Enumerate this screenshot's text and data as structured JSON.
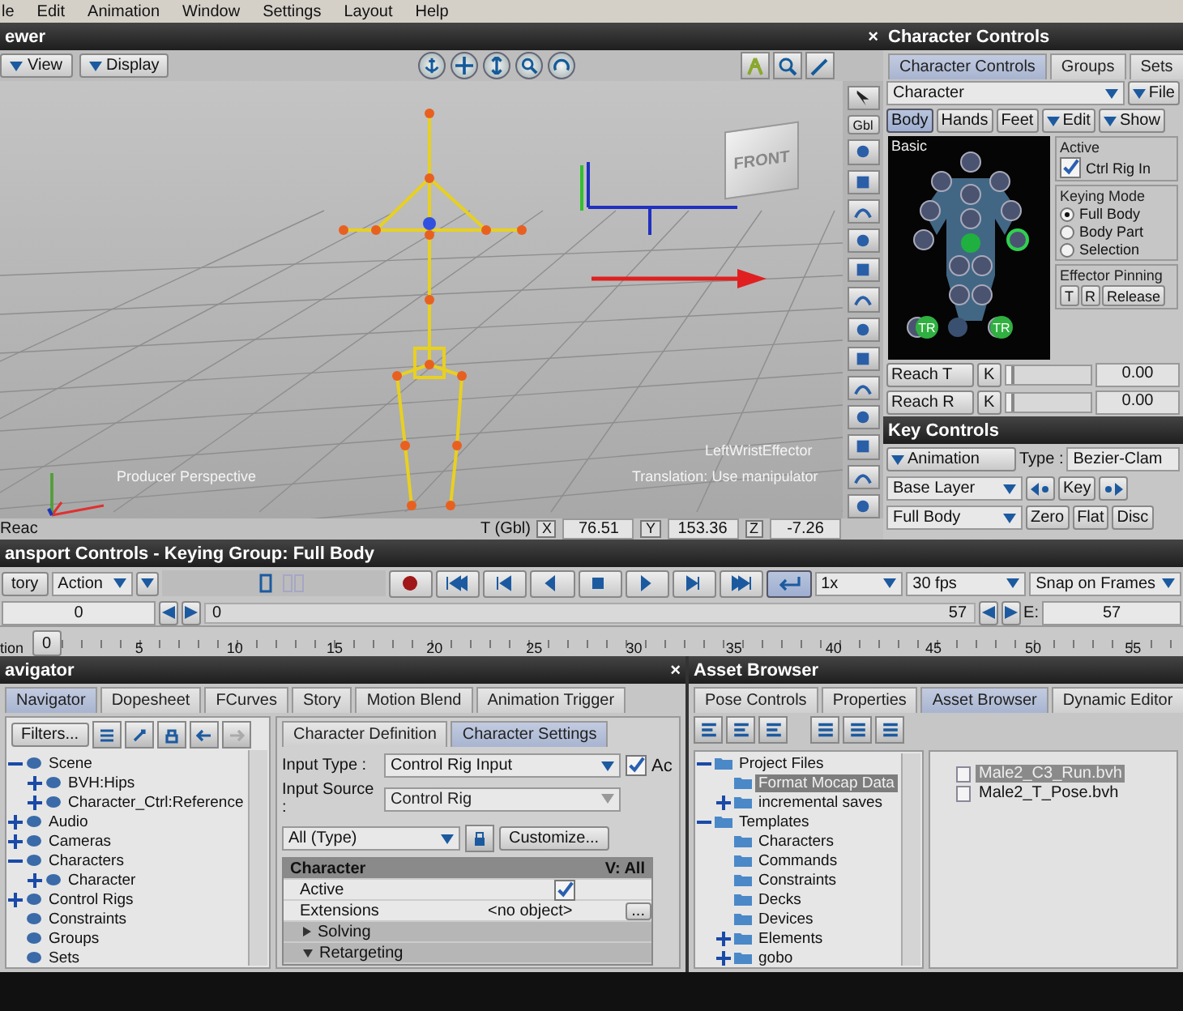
{
  "menu_bar": [
    "le",
    "Edit",
    "Animation",
    "Window",
    "Settings",
    "Layout",
    "Help"
  ],
  "viewer": {
    "title": "ewer",
    "close": "×",
    "menus": [
      "View",
      "Display"
    ],
    "camera_label": "Producer Perspective",
    "effector_label": "LeftWristEffector",
    "mode_label": "Translation: Use manipulator",
    "cube_label": "FRONT",
    "gbl_button": "Gbl",
    "status": "Reac",
    "coord_label": "T (Gbl)",
    "coords": [
      {
        "axis": "X",
        "value": "76.51"
      },
      {
        "axis": "Y",
        "value": "153.36"
      },
      {
        "axis": "Z",
        "value": "-7.26"
      }
    ]
  },
  "character_controls": {
    "title": "Character Controls",
    "tabs": [
      {
        "label": "Character Controls",
        "selected": true
      },
      {
        "label": "Groups",
        "selected": false
      },
      {
        "label": "Sets",
        "selected": false
      }
    ],
    "character": "Character",
    "file_menu": "File",
    "body_tabs": [
      {
        "label": "Body",
        "selected": true
      },
      {
        "label": "Hands",
        "selected": false
      },
      {
        "label": "Feet",
        "selected": false
      }
    ],
    "edit_menu": "Edit",
    "show_menu": "Show",
    "figure_label": "Basic",
    "effector_badges": [
      "TR",
      "TR"
    ],
    "active": {
      "label": "Active",
      "option": "Ctrl Rig In",
      "checked": true
    },
    "keying_mode": {
      "label": "Keying Mode",
      "options": [
        {
          "label": "Full Body",
          "selected": true
        },
        {
          "label": "Body Part",
          "selected": false
        },
        {
          "label": "Selection",
          "selected": false
        }
      ]
    },
    "effector_pinning": {
      "label": "Effector Pinning",
      "buttons": [
        "T",
        "R",
        "Release"
      ]
    },
    "reach": [
      {
        "label": "Reach T",
        "key": "K",
        "level": 0.06,
        "value": "0.00"
      },
      {
        "label": "Reach R",
        "key": "K",
        "level": 0.06,
        "value": "0.00"
      }
    ]
  },
  "key_controls": {
    "title": "Key Controls",
    "mode": "Animation",
    "type_label": "Type :",
    "type": "Bezier-Clam",
    "layer": "Base Layer",
    "key": "Key",
    "group": "Full Body",
    "buttons": [
      "Zero",
      "Flat",
      "Disc"
    ]
  },
  "transport": {
    "title": "ansport Controls  -  Keying Group: Full Body",
    "tab": "tory",
    "take": "Action",
    "loop": true,
    "speed": "1x",
    "fps": "30 fps",
    "snap": "Snap on Frames",
    "start": "0",
    "current": "0",
    "end_current": "57",
    "end_label": "E:",
    "end": "57",
    "ruler_label": "tion",
    "ruler_handle": "0",
    "ticks": [
      "5",
      "10",
      "15",
      "20",
      "25",
      "30",
      "35",
      "40",
      "45",
      "50",
      "55"
    ]
  },
  "navigator": {
    "title": "avigator",
    "close": "×",
    "tabs": [
      {
        "label": "Navigator",
        "selected": true
      },
      {
        "label": "Dopesheet",
        "selected": false
      },
      {
        "label": "FCurves",
        "selected": false
      },
      {
        "label": "Story",
        "selected": false
      },
      {
        "label": "Motion Blend",
        "selected": false
      },
      {
        "label": "Animation Trigger",
        "selected": false
      }
    ],
    "filters": "Filters...",
    "tree": [
      {
        "label": "Scene",
        "expanded": true,
        "children": [
          {
            "label": "BVH:Hips",
            "expanded": false
          },
          {
            "label": "Character_Ctrl:Reference",
            "expanded": false
          }
        ]
      },
      {
        "label": "Audio",
        "expanded": false
      },
      {
        "label": "Cameras",
        "expanded": false
      },
      {
        "label": "Characters",
        "expanded": true,
        "children": [
          {
            "label": "Character",
            "expanded": false
          }
        ]
      },
      {
        "label": "Control Rigs",
        "expanded": false
      },
      {
        "label": "Constraints"
      },
      {
        "label": "Groups"
      },
      {
        "label": "Sets"
      }
    ],
    "subtabs": [
      {
        "label": "Character Definition",
        "selected": false
      },
      {
        "label": "Character Settings",
        "selected": true
      }
    ],
    "input_type_label": "Input Type :",
    "input_type": "Control Rig Input",
    "active_label": "Ac",
    "active_checked": true,
    "input_source_label": "Input Source :",
    "input_source": "Control Rig",
    "filter": "All (Type)",
    "customize": "Customize...",
    "grid": {
      "header": "Character",
      "header_value": "V: All",
      "rows": [
        {
          "kind": "check",
          "label": "Active",
          "checked": true
        },
        {
          "kind": "object",
          "label": "Extensions",
          "value": "<no object>",
          "button": "..."
        },
        {
          "kind": "group",
          "label": "Solving",
          "expanded": false
        },
        {
          "kind": "group",
          "label": "Retargeting",
          "expanded": true
        }
      ]
    }
  },
  "asset_browser": {
    "title": "Asset Browser",
    "tabs": [
      {
        "label": "Pose Controls",
        "selected": false
      },
      {
        "label": "Properties",
        "selected": false
      },
      {
        "label": "Asset Browser",
        "selected": true
      },
      {
        "label": "Dynamic Editor",
        "selected": false
      }
    ],
    "tree": [
      {
        "label": "Project Files",
        "expanded": true,
        "selected": false,
        "children": [
          {
            "label": "Format Mocap Data",
            "selected": true
          },
          {
            "label": "incremental saves",
            "expanded": false,
            "selected": false
          }
        ]
      },
      {
        "label": "Templates",
        "expanded": true,
        "selected": false,
        "children": [
          {
            "label": "Characters",
            "selected": false
          },
          {
            "label": "Commands",
            "selected": false
          },
          {
            "label": "Constraints",
            "selected": false
          },
          {
            "label": "Decks",
            "selected": false
          },
          {
            "label": "Devices",
            "selected": false
          },
          {
            "label": "Elements",
            "expanded": false,
            "selected": false
          },
          {
            "label": "gobo",
            "expanded": false,
            "selected": false
          }
        ]
      }
    ],
    "files": [
      {
        "name": "Male2_C3_Run.bvh",
        "selected": true
      },
      {
        "name": "Male2_T_Pose.bvh",
        "selected": false
      }
    ]
  }
}
